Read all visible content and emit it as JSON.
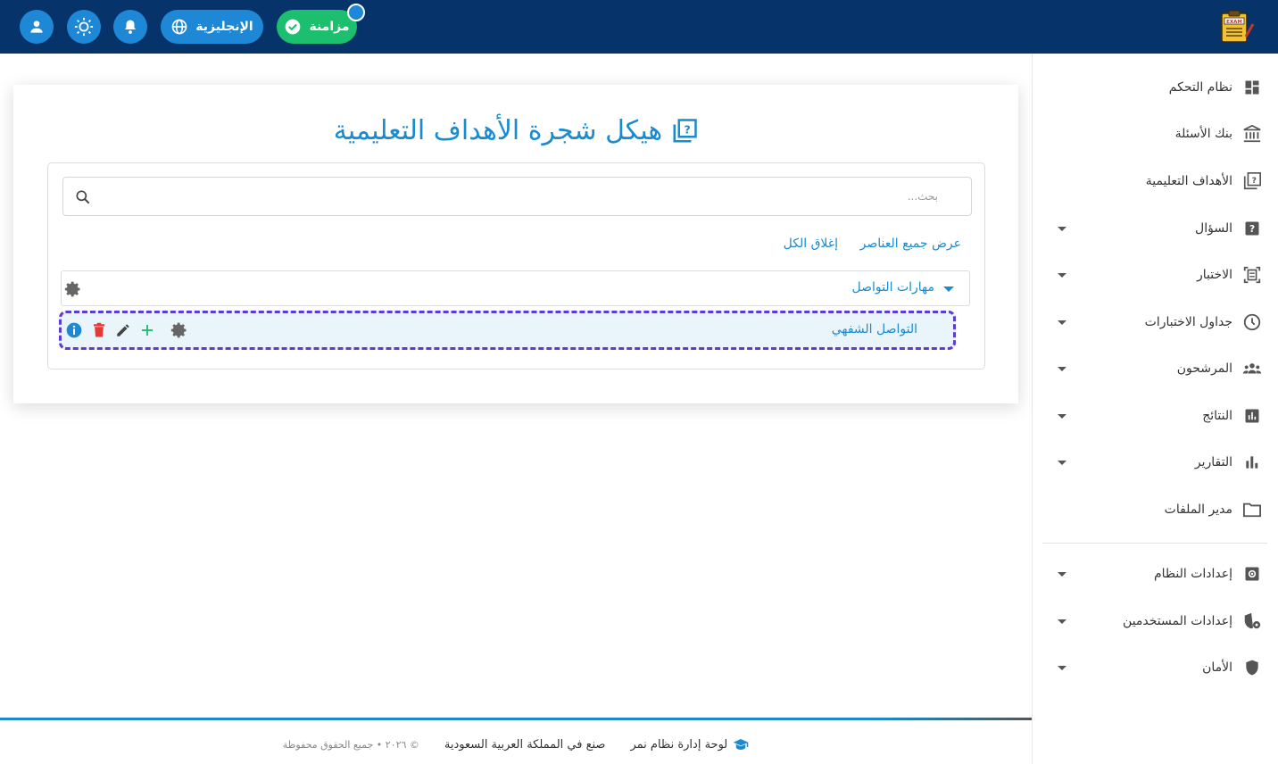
{
  "topbar": {
    "sync_label": "مزامنة",
    "language_label": "الإنجليزية",
    "icons": [
      "user-icon",
      "theme-sun-icon",
      "bell-icon",
      "globe-icon",
      "check-circle-icon"
    ],
    "logo_text": "EXAM"
  },
  "sidebar": {
    "items": [
      {
        "label": "نظام التحكم",
        "icon": "dashboard-icon",
        "has_caret": false
      },
      {
        "label": "بنك الأسئلة",
        "icon": "bank-icon",
        "has_caret": false
      },
      {
        "label": "الأهداف التعليمية",
        "icon": "objectives-icon",
        "has_caret": false
      },
      {
        "label": "السؤال",
        "icon": "question-icon",
        "has_caret": true
      },
      {
        "label": "الاختبار",
        "icon": "exam-icon",
        "has_caret": true
      },
      {
        "label": "جداول الاختبارات",
        "icon": "clock-icon",
        "has_caret": true
      },
      {
        "label": "المرشحون",
        "icon": "candidates-icon",
        "has_caret": true
      },
      {
        "label": "النتائج",
        "icon": "results-icon",
        "has_caret": true
      },
      {
        "label": "التقارير",
        "icon": "reports-icon",
        "has_caret": true
      },
      {
        "label": "مدير الملفات",
        "icon": "folder-icon",
        "has_caret": false
      },
      {
        "label": "إعدادات النظام",
        "icon": "system-settings-icon",
        "has_caret": true
      },
      {
        "label": "إعدادات المستخدمين",
        "icon": "user-settings-icon",
        "has_caret": true
      },
      {
        "label": "الأمان",
        "icon": "shield-icon",
        "has_caret": true
      }
    ]
  },
  "main": {
    "title": "هيكل شجرة الأهداف التعليمية",
    "search_placeholder": "بحث...",
    "show_all_label": "عرض جميع العناصر",
    "close_all_label": "إغلاق الكل",
    "tree": {
      "parent_label": "مهارات التواصل",
      "child_label": "التواصل الشفهي"
    }
  },
  "footer": {
    "brand": "لوحة إدارة نظام نمر",
    "made_in": "صنع في المملكة العربية السعودية",
    "copyright": "© ٢٠٢٦ • جميع الحقوق محفوظة"
  },
  "colors": {
    "topbar": "#06336a",
    "accent": "#1a8bce",
    "sync_green": "#1cbf6e",
    "button_blue": "#1e88d6",
    "selection_dashed": "#5e3ad6",
    "delete_red": "#e53935",
    "info_blue": "#1e88d6",
    "add_green": "#1cbf6e"
  }
}
